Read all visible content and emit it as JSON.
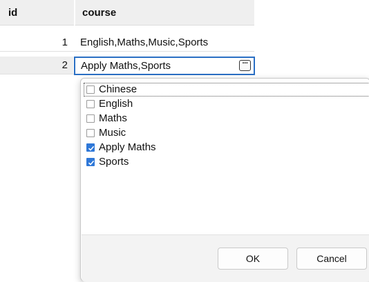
{
  "grid": {
    "columns": [
      "id",
      "course"
    ],
    "rows": [
      {
        "id": "1",
        "course": "English,Maths,Music,Sports"
      },
      {
        "id": "2",
        "course": "Apply Maths,Sports"
      }
    ],
    "editor_button_label": "···"
  },
  "popup": {
    "items": [
      {
        "label": "Chinese",
        "checked": false
      },
      {
        "label": "English",
        "checked": false
      },
      {
        "label": "Maths",
        "checked": false
      },
      {
        "label": "Music",
        "checked": false
      },
      {
        "label": "Apply Maths",
        "checked": true
      },
      {
        "label": "Sports",
        "checked": true
      }
    ],
    "ok_label": "OK",
    "cancel_label": "Cancel"
  },
  "colors": {
    "accent": "#2a6fc4",
    "checkbox_checked": "#2f78d8",
    "header_bg": "#efefef"
  }
}
